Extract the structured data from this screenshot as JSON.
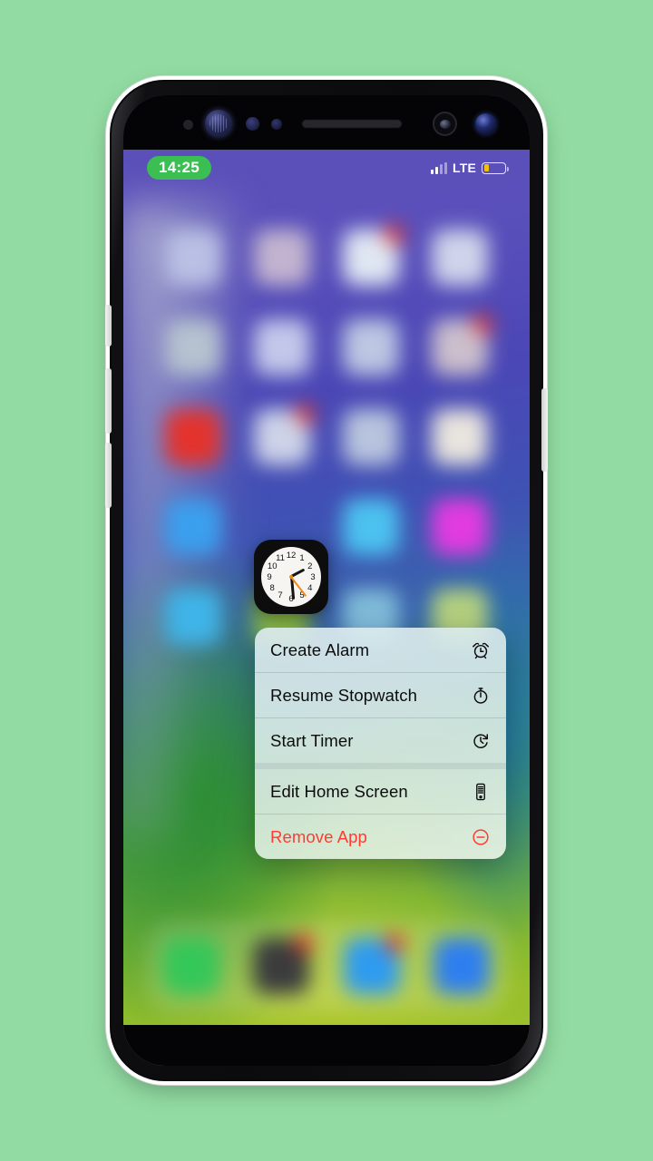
{
  "stage": {
    "background_color": "#92dca3"
  },
  "device": {
    "name": "smartphone-mockup",
    "frame_color": "#0a0a0c",
    "bezel_color": "#040406",
    "sensors": [
      "proximity-dot",
      "iris-scanner",
      "sensor-dot",
      "sensor-dot",
      "earpiece-speaker",
      "camera-ring",
      "front-camera-lens"
    ],
    "buttons": [
      "volume-up",
      "volume-down",
      "bixby",
      "power"
    ]
  },
  "status_bar": {
    "time": "14:25",
    "time_pill_color": "#3bbf52",
    "network": "LTE",
    "signal_bars_total": 4,
    "signal_bars_filled": 2,
    "battery_percent": 25,
    "battery_color": "#f0c10d"
  },
  "wallpaper": {
    "description": "blurred gradient wallpaper",
    "top_color": "#5b4fb8",
    "mid_color": "#3a66ad",
    "bottom_color": "#9ec22e"
  },
  "home_screen": {
    "grid_rows": 5,
    "grid_columns": 4,
    "apps": [
      {
        "name": "app-1-1",
        "color": "#b9c0e4",
        "badge": null
      },
      {
        "name": "app-1-2",
        "color": "#c2b4cf",
        "badge": null
      },
      {
        "name": "app-1-3",
        "color": "#dfe7f2",
        "badge": "1"
      },
      {
        "name": "app-1-4",
        "color": "#cfd4ea",
        "badge": null
      },
      {
        "name": "app-2-1",
        "color": "#b6c2cf",
        "badge": null
      },
      {
        "name": "app-2-2",
        "color": "#c3c8ea",
        "badge": null
      },
      {
        "name": "app-2-3",
        "color": "#bcc7e2",
        "badge": null
      },
      {
        "name": "app-2-4",
        "color": "#cbbfcc",
        "badge": "2"
      },
      {
        "name": "app-3-1",
        "color": "#e4332c",
        "badge": null
      },
      {
        "name": "app-3-2",
        "color": "#cdd3e8",
        "badge": "3"
      },
      {
        "name": "app-3-3",
        "color": "#b8c4dd",
        "badge": null
      },
      {
        "name": "app-3-4",
        "color": "#e8e4dd",
        "badge": null
      },
      {
        "name": "app-4-1",
        "color": "#3aa0ee",
        "badge": null
      },
      {
        "name": "app-4-2",
        "color": "#0d0d0d",
        "badge": null
      },
      {
        "name": "app-4-3",
        "color": "#4cc2f0",
        "badge": null
      },
      {
        "name": "app-4-4",
        "color": "#e23be0",
        "badge": null
      },
      {
        "name": "app-5-1",
        "color": "#3fb4e8",
        "badge": null
      },
      {
        "name": "app-5-2",
        "color": "#8fc24a",
        "badge": null
      },
      {
        "name": "app-5-3",
        "color": "#7fbad8",
        "badge": null
      },
      {
        "name": "app-5-4",
        "color": "#b3cf7e",
        "badge": null
      }
    ],
    "dock": [
      {
        "name": "dock-phone",
        "color": "#34c759",
        "badge": null
      },
      {
        "name": "dock-app-dark",
        "color": "#3b3b3d",
        "badge": "1"
      },
      {
        "name": "dock-messages",
        "color": "#2e9bf0",
        "badge": "1"
      },
      {
        "name": "dock-safari",
        "color": "#2e7ef0",
        "badge": null
      }
    ]
  },
  "focused_app": {
    "name": "clock-app-icon",
    "label": "Clock",
    "face_color": "#f7f5f1",
    "case_color": "#0d0d0d",
    "hour_angle": 62,
    "minute_angle": 175,
    "second_angle": 142,
    "second_hand_color": "#f08b1c",
    "numerals": [
      "1",
      "2",
      "3",
      "4",
      "5",
      "6",
      "7",
      "8",
      "9",
      "10",
      "11",
      "12"
    ]
  },
  "context_menu": {
    "name": "app-context-menu",
    "destructive_color": "#ff3b30",
    "items": [
      {
        "label": "Create Alarm",
        "icon": "alarm-clock-icon",
        "destructive": false
      },
      {
        "label": "Resume Stopwatch",
        "icon": "stopwatch-icon",
        "destructive": false
      },
      {
        "label": "Start Timer",
        "icon": "timer-icon",
        "destructive": false
      },
      {
        "label": "Edit Home Screen",
        "icon": "home-screen-icon",
        "destructive": false
      },
      {
        "label": "Remove App",
        "icon": "remove-circle-icon",
        "destructive": true
      }
    ]
  }
}
